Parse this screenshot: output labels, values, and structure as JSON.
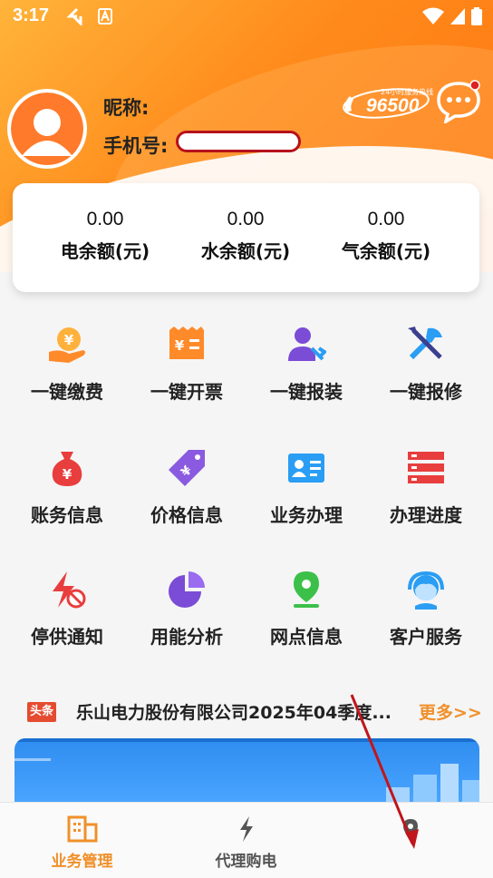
{
  "status_bar": {
    "time": "3:17"
  },
  "profile": {
    "nickname_label": "昵称:",
    "phone_label": "手机号:",
    "hotline_text": "96500",
    "hotline_sub": "24小时服务热线"
  },
  "balances": [
    {
      "value": "0.00",
      "label": "电余额(元)"
    },
    {
      "value": "0.00",
      "label": "水余额(元)"
    },
    {
      "value": "0.00",
      "label": "气余额(元)"
    }
  ],
  "services": [
    {
      "label": "一键缴费",
      "icon": "pay-icon"
    },
    {
      "label": "一键开票",
      "icon": "invoice-icon"
    },
    {
      "label": "一键报装",
      "icon": "install-icon"
    },
    {
      "label": "一键报修",
      "icon": "repair-icon"
    },
    {
      "label": "账务信息",
      "icon": "money-bag-icon"
    },
    {
      "label": "价格信息",
      "icon": "price-tag-icon"
    },
    {
      "label": "业务办理",
      "icon": "id-card-icon"
    },
    {
      "label": "办理进度",
      "icon": "progress-icon"
    },
    {
      "label": "停供通知",
      "icon": "outage-icon"
    },
    {
      "label": "用能分析",
      "icon": "pie-chart-icon"
    },
    {
      "label": "网点信息",
      "icon": "location-icon"
    },
    {
      "label": "客户服务",
      "icon": "headset-icon"
    }
  ],
  "news": {
    "tag": "头条",
    "text": "乐山电力股份有限公司2025年04季度...",
    "more": "更多>>"
  },
  "tabbar": [
    {
      "label": "业务管理",
      "active": true
    },
    {
      "label": "代理购电",
      "active": false
    }
  ],
  "colors": {
    "accent": "#ff8b1c",
    "active_tab": "#f0902a",
    "inactive_tab": "#555555"
  }
}
